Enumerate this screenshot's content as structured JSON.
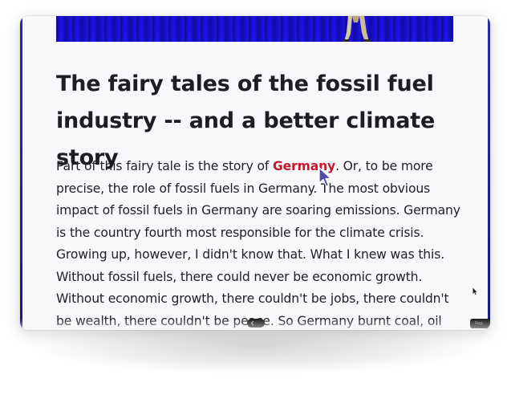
{
  "article": {
    "title": "The fairy tales of the fossil fuel industry -- and a better climate story",
    "paragraph_before_link": "Part of this fairy tale is the story of ",
    "link_text": "Germany",
    "paragraph_after_link": ". Or, to be more precise, the role of fossil fuels in Germany. The most obvious impact of fossil fuels in Germany are soaring emissions. Germany is the country fourth most responsible for the climate crisis. Growing up, however, I didn't know that. What I knew was this. Without fossil fuels, there could never be economic growth. Without economic growth, there couldn't be jobs, there couldn't be wealth, there couldn't be peace. So Germany burnt coal, oil and gas no"
  },
  "player": {
    "badge_text": "Rep"
  },
  "icons": {
    "cursor": "pointer-cursor-icon",
    "scrub": "chevron-icon",
    "mini_pointer": "mini-pointer-icon"
  },
  "colors": {
    "hero_blue": "#1e14f0",
    "link_red": "#c6172f",
    "text": "#1f1f24",
    "frame_edge": "#2a2aa8"
  }
}
